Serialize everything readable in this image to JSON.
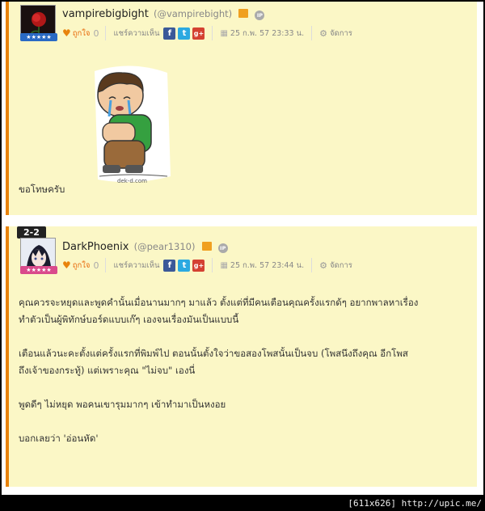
{
  "posts": [
    {
      "number": "",
      "username": "vampirebigbight",
      "handle": "(@vampirebight)",
      "like_label": "ถูกใจ",
      "like_count": "0",
      "share_label": "แชร์ความเห็น",
      "timestamp": "25 ก.พ. 57 23:33 น.",
      "manage_label": "จัดการ",
      "image_caption": "dek-d.com",
      "body": [
        "ขอโทษครับ"
      ],
      "rank_color": "#2a6ac4"
    },
    {
      "number": "2-2",
      "username": "DarkPhoenix",
      "handle": "(@pear1310)",
      "like_label": "ถูกใจ",
      "like_count": "0",
      "share_label": "แชร์ความเห็น",
      "timestamp": "25 ก.พ. 57 23:44 น.",
      "manage_label": "จัดการ",
      "body": [
        "คุณควรจะหยุดและพูดคำนั้นเมื่อนานมากๆ มาแล้ว ตั้งแต่ที่มีคนเตือนคุณครั้งแรกด้ๆ อยากพาลหาเรื่อง",
        "ทำตัวเป็นผู้พิทักษ์บอร์ดแบบเก๊ๆ เองจนเรื่องมันเป็นแบบนี้",
        "เตือนแล้วนะคะตั้งแต่ครั้งแรกที่พิมพ์ไป ตอนนั้นตั้งใจว่าขอสองโพสนั้นเป็นจบ (โพสนึงถึงคุณ อีกโพส",
        "ถึงเจ้าของกระทู้) แต่เพราะคุณ \"ไม่จบ\" เองนี่",
        "พูดดีๆ ไม่หยุด พอคนเขารุมมากๆ เข้าทำมาเป็นหงอย",
        "บอกเลยว่า 'อ่อนหัด'"
      ],
      "rank_color": "#d94a8c"
    }
  ],
  "footer": "[611x626] http://upic.me/"
}
